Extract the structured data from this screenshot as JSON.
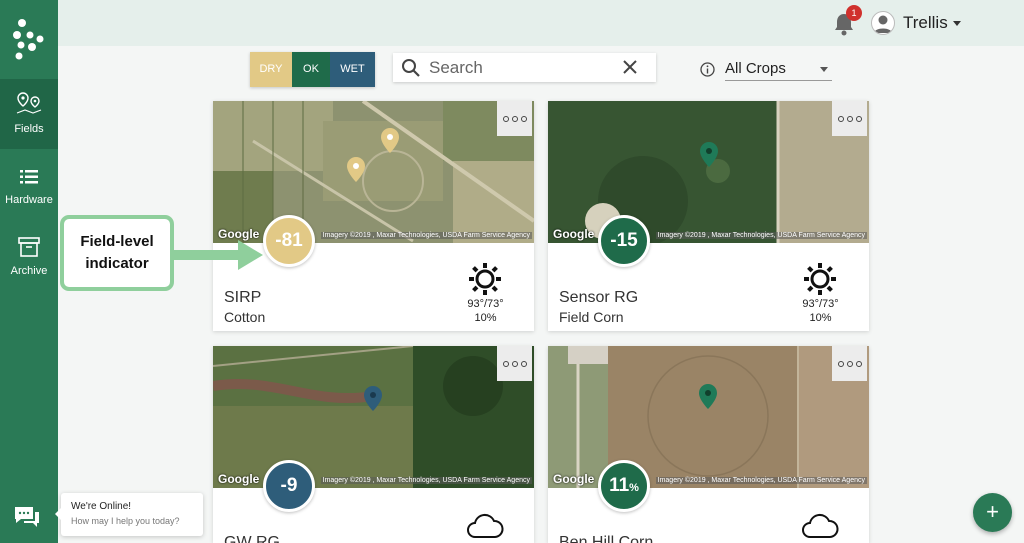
{
  "sidebar": {
    "items": [
      {
        "label": "Fields",
        "icon": "map-pins-icon",
        "active": true
      },
      {
        "label": "Hardware",
        "icon": "list-icon",
        "active": false
      },
      {
        "label": "Archive",
        "icon": "archive-box-icon",
        "active": false
      }
    ]
  },
  "header": {
    "notification_count": "1",
    "user_name": "Trellis"
  },
  "toolbar": {
    "moisture_filters": [
      "DRY",
      "OK",
      "WET"
    ],
    "search_placeholder": "Search",
    "crop_filter_value": "All Crops"
  },
  "colors": {
    "brand": "#2a7a56",
    "dry": "#e2c986",
    "ok": "#1f6b4a",
    "wet": "#2e5d7a"
  },
  "map_attribution": {
    "google": "Google",
    "text": "Imagery ©2019 , Maxar Technologies, USDA Farm Service Agency"
  },
  "cards": [
    {
      "name": "SIRP",
      "crop": "Cotton",
      "indicator": "-81",
      "unit": "",
      "status": "dry",
      "weather": "sun-icon",
      "temps": "93°/73°",
      "rain": "10%"
    },
    {
      "name": "Sensor RG",
      "crop": "Field Corn",
      "indicator": "-15",
      "unit": "",
      "status": "ok",
      "weather": "sun-icon",
      "temps": "93°/73°",
      "rain": "10%"
    },
    {
      "name": "GW RG",
      "crop": "",
      "indicator": "-9",
      "unit": "",
      "status": "wet",
      "weather": "cloud-icon",
      "temps": "",
      "rain": ""
    },
    {
      "name": "Ben Hill Corn",
      "crop": "",
      "indicator": "11",
      "unit": "%",
      "status": "ok",
      "weather": "cloud-icon",
      "temps": "",
      "rain": ""
    }
  ],
  "annotation": {
    "line1": "Field-level",
    "line2": "indicator"
  },
  "chat": {
    "title": "We're Online!",
    "subtitle": "How may I help you today?"
  },
  "fab_label": "+"
}
